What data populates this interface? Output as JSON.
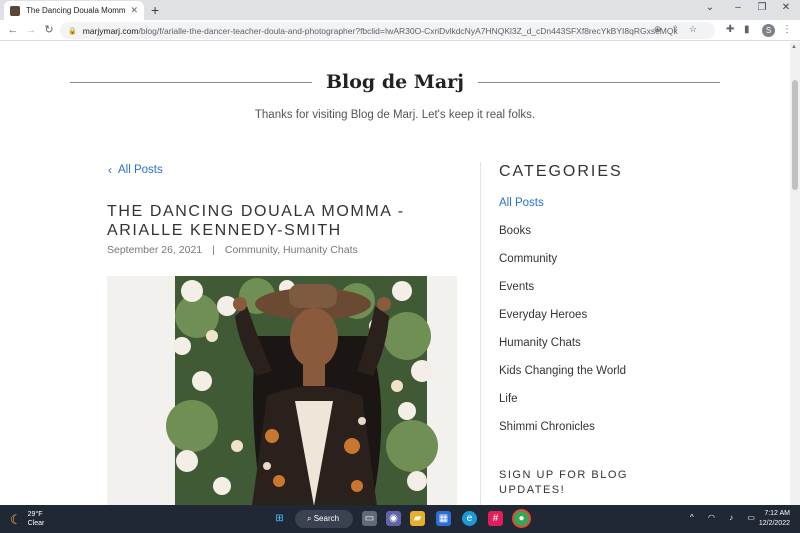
{
  "browser": {
    "tab_title": "The Dancing Douala Momma - A",
    "url_host": "marjymarj.com",
    "url_path": "/blog/f/arialle-the-dancer-teacher-doula-and-photographer?fbclid=IwAR30O-CxriDvlkdcNyA7HNQKl3Z_d_cDn443SFXf8recYkBYI8qRGxseMQk",
    "profile_initial": "S"
  },
  "page": {
    "blog_title": "Blog de Marj",
    "tagline": "Thanks for visiting Blog de Marj.  Let's keep it real folks.",
    "back_link": "All Posts",
    "post_title": "THE DANCING DOUALA MOMMA - ARIALLE KENNEDY-SMITH",
    "post_date": "September 26, 2021",
    "meta_sep": "|",
    "post_categories": "Community, Humanity Chats",
    "categories_heading": "CATEGORIES",
    "categories": [
      {
        "label": "All Posts"
      },
      {
        "label": "Books"
      },
      {
        "label": "Community"
      },
      {
        "label": "Events"
      },
      {
        "label": "Everyday Heroes"
      },
      {
        "label": "Humanity Chats"
      },
      {
        "label": "Kids Changing the World"
      },
      {
        "label": "Life"
      },
      {
        "label": "Shimmi Chronicles"
      }
    ],
    "signup_heading": "SIGN UP FOR BLOG UPDATES!"
  },
  "taskbar": {
    "weather_temp": "29°F",
    "weather_desc": "Clear",
    "search_label": "Search",
    "time": "7:12 AM",
    "date": "12/2/2022"
  },
  "colors": {
    "link_blue": "#2a6fd6",
    "taskbar_bg": "#202836"
  }
}
